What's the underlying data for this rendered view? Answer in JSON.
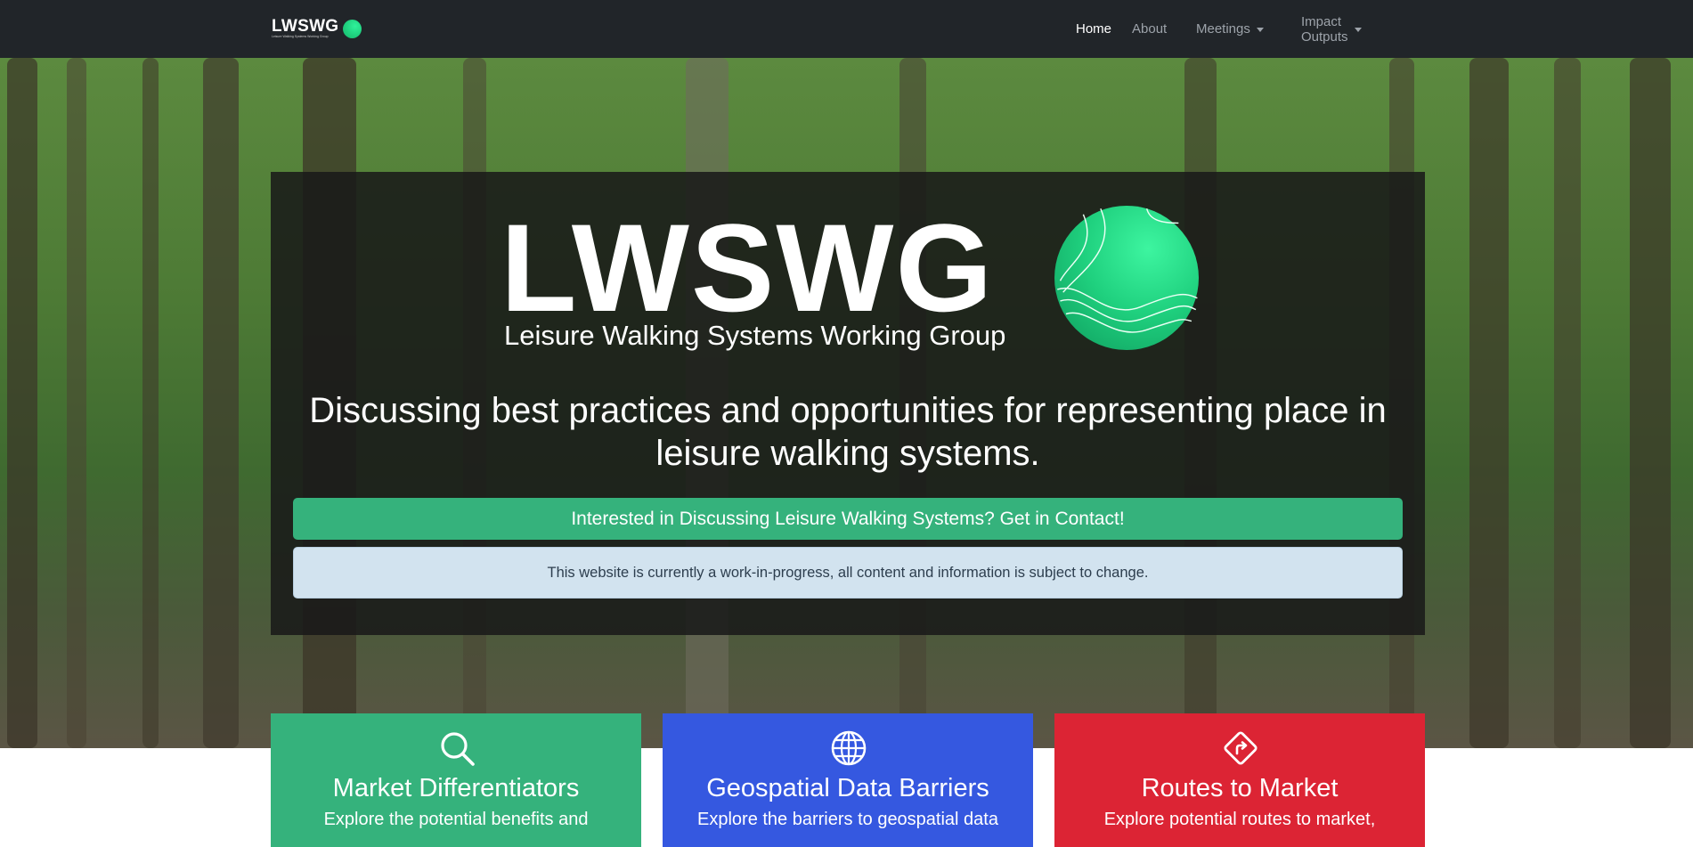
{
  "navbar": {
    "brand": {
      "title": "LWSWG",
      "subtitle": "Leisure Walking Systems Working Group"
    },
    "items": [
      {
        "label": "Home",
        "active": true
      },
      {
        "label": "About"
      },
      {
        "label": "Meetings",
        "dropdown": true
      },
      {
        "label": "Impact Outputs",
        "dropdown": true
      }
    ]
  },
  "hero": {
    "logo_title": "LWSWG",
    "logo_subtitle": "Leisure Walking Systems Working Group",
    "tagline": "Discussing best practices and opportunities for representing place in leisure walking systems.",
    "contact_button": "Interested in Discussing Leisure Walking Systems? Get in Contact!",
    "notice": "This website is currently a work-in-progress, all content and information is subject to change."
  },
  "cards": [
    {
      "title": "Market Differentiators",
      "description": "Explore the potential benefits and",
      "icon": "search-icon",
      "color": "#35b27c"
    },
    {
      "title": "Geospatial Data Barriers",
      "description": "Explore the barriers to geospatial data",
      "icon": "globe-icon",
      "color": "#3558e0"
    },
    {
      "title": "Routes to Market",
      "description": "Explore potential routes to market,",
      "icon": "route-sign-icon",
      "color": "#dc2434"
    }
  ],
  "colors": {
    "navbar": "#212529",
    "success": "#35b27c",
    "primary": "#3558e0",
    "danger": "#dc2434",
    "info_bg": "#d2e3ef"
  }
}
